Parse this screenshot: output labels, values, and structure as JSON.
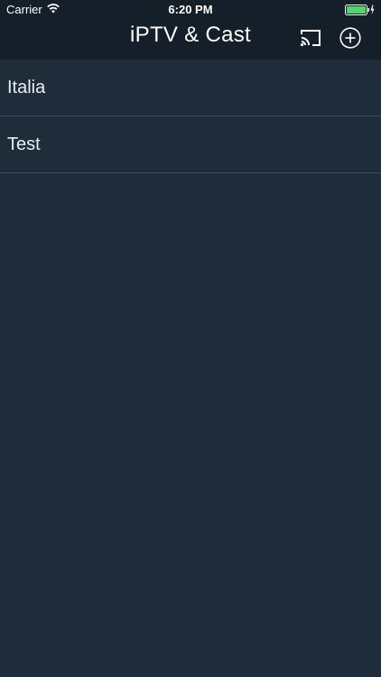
{
  "status_bar": {
    "carrier": "Carrier",
    "time": "6:20 PM"
  },
  "header": {
    "title": "iPTV & Cast",
    "cast_icon": "cast-icon",
    "add_icon": "add-circle-icon"
  },
  "playlists": [
    {
      "label": "Italia"
    },
    {
      "label": "Test"
    }
  ],
  "colors": {
    "header_bg": "#141f29",
    "background": "#1f2d3a",
    "separator": "#3c4e5e",
    "battery": "#4cd964"
  }
}
